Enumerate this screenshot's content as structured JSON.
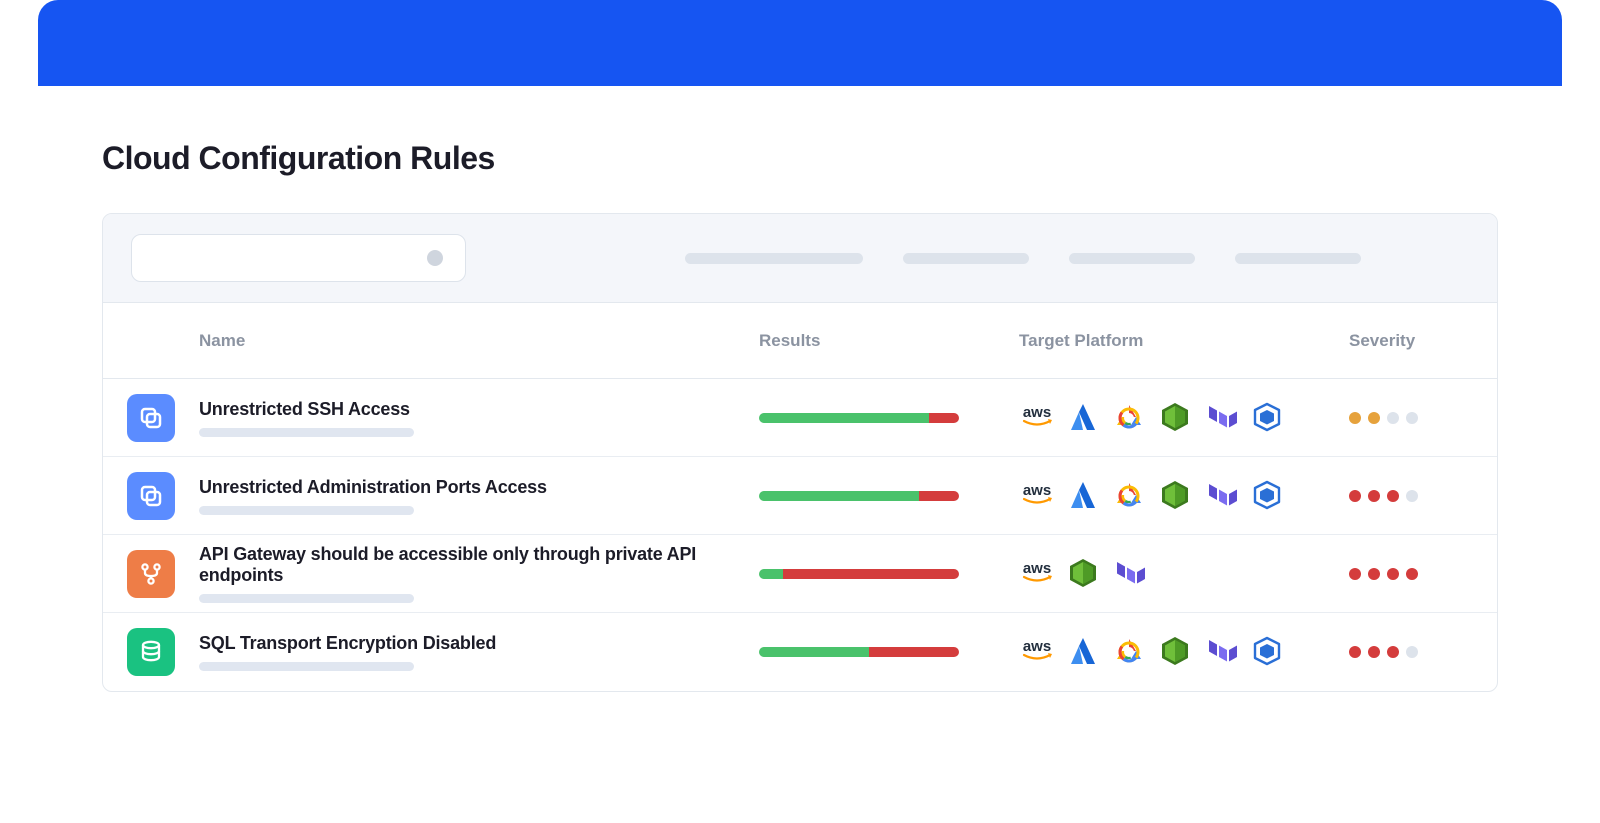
{
  "page": {
    "title": "Cloud Configuration Rules"
  },
  "columns": {
    "name": "Name",
    "results": "Results",
    "target": "Target Platform",
    "severity": "Severity"
  },
  "rules": [
    {
      "name": "Unrestricted SSH Access",
      "icon": "copy-icon",
      "iconColor": "blue",
      "results": {
        "ok": 85,
        "fail": 15
      },
      "platforms": [
        "aws",
        "azure",
        "gcp",
        "shield",
        "terraform",
        "cube"
      ],
      "severity": {
        "level": 2,
        "color": "orange"
      }
    },
    {
      "name": "Unrestricted Administration Ports Access",
      "icon": "copy-icon",
      "iconColor": "blue",
      "results": {
        "ok": 80,
        "fail": 20
      },
      "platforms": [
        "aws",
        "azure",
        "gcp",
        "shield",
        "terraform",
        "cube"
      ],
      "severity": {
        "level": 3,
        "color": "red"
      }
    },
    {
      "name": "API Gateway should be accessible only through private API endpoints",
      "icon": "branch-icon",
      "iconColor": "orange",
      "results": {
        "ok": 12,
        "fail": 88
      },
      "platforms": [
        "aws",
        "shield",
        "terraform"
      ],
      "severity": {
        "level": 4,
        "color": "red"
      }
    },
    {
      "name": "SQL Transport Encryption Disabled",
      "icon": "database-icon",
      "iconColor": "green",
      "results": {
        "ok": 55,
        "fail": 45
      },
      "platforms": [
        "aws",
        "azure",
        "gcp",
        "shield",
        "terraform",
        "cube"
      ],
      "severity": {
        "level": 3,
        "color": "red"
      }
    }
  ]
}
